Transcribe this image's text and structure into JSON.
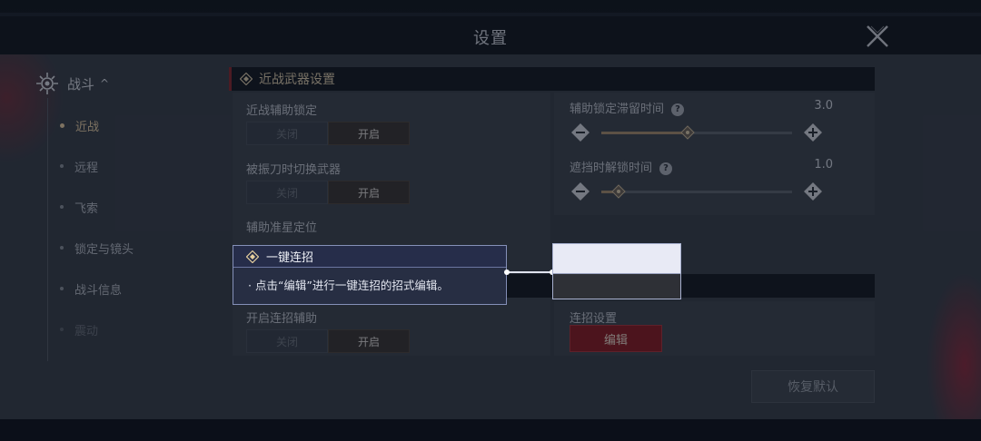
{
  "header": {
    "title": "设置"
  },
  "sidebar": {
    "category": {
      "label": "战斗",
      "chevron": "^"
    },
    "items": [
      {
        "label": "近战",
        "state": "active"
      },
      {
        "label": "远程",
        "state": "normal"
      },
      {
        "label": "飞索",
        "state": "normal"
      },
      {
        "label": "锁定与镜头",
        "state": "normal"
      },
      {
        "label": "战斗信息",
        "state": "normal"
      },
      {
        "label": "震动",
        "state": "dim"
      }
    ]
  },
  "section": {
    "title": "近战武器设置"
  },
  "toggles": {
    "off_label": "关闭",
    "on_label": "开启",
    "melee_assist_lock": {
      "label": "近战辅助锁定",
      "value": "开启"
    },
    "switch_weapon_on_block": {
      "label": "被振刀时切换武器",
      "value": "开启"
    },
    "aim_star": {
      "label": "辅助准星定位"
    },
    "combo_assist": {
      "label": "开启连招辅助",
      "value": "开启"
    }
  },
  "sliders": {
    "lock_linger": {
      "label": "辅助锁定滞留时间",
      "value": "3.0",
      "fraction": 0.45
    },
    "block_unlock": {
      "label": "遮挡时解锁时间",
      "value": "1.0",
      "fraction": 0.09
    }
  },
  "combo_settings": {
    "label": "连招设置",
    "edit_label": "编辑"
  },
  "reset_label": "恢复默认",
  "tooltip": {
    "title": "一键连招",
    "body": "· 点击“编辑”进行一键连招的招式编辑。"
  },
  "icons": {
    "close": "close-x-icon",
    "category": "combat-gear-icon",
    "section": "diamond-icon",
    "help": "question-icon",
    "minus": "minus-icon",
    "plus": "plus-icon"
  },
  "colors": {
    "accent_red": "#8a1d22",
    "accent_gold": "#e3c9a0",
    "tooltip_border": "#8590b8"
  }
}
